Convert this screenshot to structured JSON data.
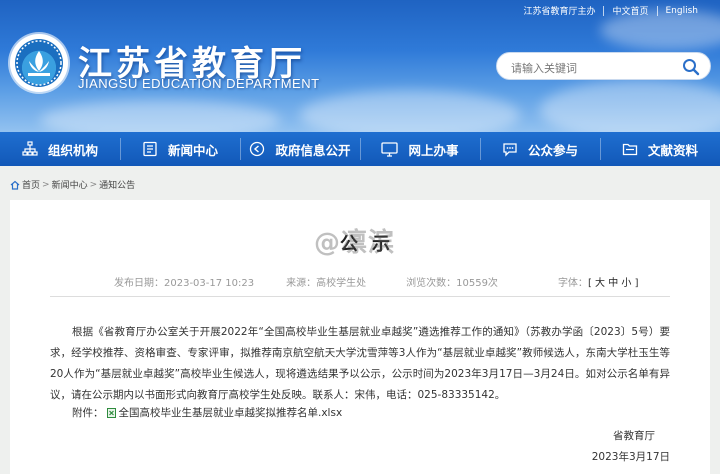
{
  "colors": {
    "brand_blue": "#1a63c6",
    "nav_blue": "#1258b8",
    "background": "#eef0ee"
  },
  "header": {
    "top_links": [
      "江苏省教育厅主办",
      "中文首页",
      "English"
    ],
    "title": "江苏省教育厅",
    "subtitle": "JIANGSU EDUCATION DEPARTMENT",
    "logo_icon": "education-emblem-icon"
  },
  "search": {
    "placeholder": "请输入关键词",
    "icon": "search-icon"
  },
  "nav": [
    {
      "label": "组织机构",
      "icon": "org-chart-icon"
    },
    {
      "label": "新闻中心",
      "icon": "document-icon"
    },
    {
      "label": "政府信息公开",
      "icon": "play-circle-icon"
    },
    {
      "label": "网上办事",
      "icon": "monitor-icon"
    },
    {
      "label": "公众参与",
      "icon": "chat-icon"
    },
    {
      "label": "文献资料",
      "icon": "folder-icon"
    }
  ],
  "breadcrumb": {
    "items": [
      "首页",
      "新闻中心",
      "通知公告"
    ],
    "separator": ">",
    "icon": "home-icon"
  },
  "article": {
    "watermark": "@凛滨",
    "title": "公示",
    "meta": {
      "published": "发布日期：2023-03-17 10:23",
      "source": "来源：高校学生处",
      "views": "浏览次数：10559次",
      "font_label": "字体：",
      "font_open": "[",
      "font_sizes": [
        "大",
        "中",
        "小"
      ],
      "font_close": "]"
    },
    "paragraph": "根据《省教育厅办公室关于开展2022年“全国高校毕业生基层就业卓越奖”遴选推荐工作的通知》（苏教办学函〔2023〕5号）要求，经学校推荐、资格审查、专家评审，拟推荐南京航空航天大学沈雪萍等3人作为“基层就业卓越奖”教师候选人，东南大学杜玉生等20人作为“基层就业卓越奖”高校毕业生候选人，现将遴选结果予以公示，公示时间为2023年3月17日—3月24日。如对公示名单有异议，请在公示期内以书面形式向教育厅高校学生处反映。联系人：宋伟，电话：025-83335142。",
    "attachment_label": "附件：",
    "attachment_file": "全国高校毕业生基层就业卓越奖拟推荐名单.xlsx",
    "attachment_icon": "excel-file-icon",
    "signature": "省教育厅",
    "date": "2023年3月17日"
  }
}
